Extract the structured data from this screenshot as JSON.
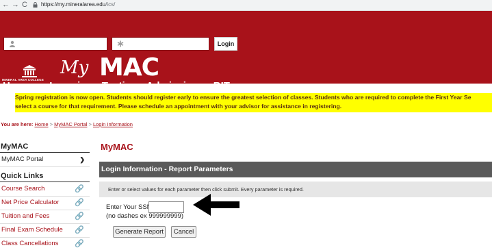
{
  "browser": {
    "back": "←",
    "forward": "→",
    "reload": "C",
    "url_host": "https://my.mineralarea.edu",
    "url_path": "/ics/"
  },
  "header": {
    "username_placeholder": "",
    "password_placeholder": "",
    "login_label": "Login",
    "college_name": "MINERAL AREA COLLEGE",
    "brand_my": "My",
    "brand_mac": "MAC",
    "nav": [
      "Home",
      "e-Learning",
      "Testing",
      "Admissions",
      "BIT"
    ],
    "brand_color": "#a8121a"
  },
  "announcement": {
    "line1": "Spring registration is now open. Students should register early to ensure the greatest selection of classes. Students who are required to complete the First Year Se",
    "line2": "select a course for that requirement. Please schedule an appointment with your advisor for assistance in registering."
  },
  "breadcrumb": {
    "label": "You are here:",
    "items": [
      "Home",
      "MyMAC Portal",
      "Login Information"
    ],
    "separator": ">"
  },
  "sidebar": {
    "section1_title": "MyMAC",
    "portal_item": "MyMAC Portal",
    "section2_title": "Quick Links",
    "quick_links": [
      "Course Search",
      "Net Price Calculator",
      "Tuition and Fees",
      "Final Exam Schedule",
      "Class Cancellations"
    ]
  },
  "main": {
    "title": "MyMAC",
    "panel_title": "Login Information - Report Parameters",
    "instructions": "Enter or select values for each parameter then click submit. Every parameter is required.",
    "ssn_label": "Enter Your SSN",
    "ssn_value": "",
    "ssn_hint": "(no dashes ex 999999999)",
    "generate_label": "Generate Report",
    "cancel_label": "Cancel"
  }
}
